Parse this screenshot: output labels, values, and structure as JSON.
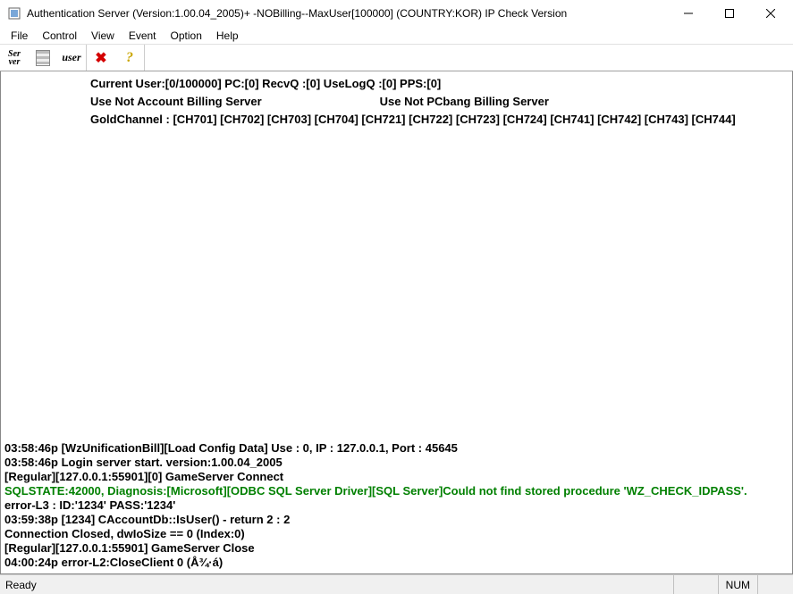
{
  "window": {
    "title": "Authentication Server (Version:1.00.04_2005)+ -NOBilling--MaxUser[100000] (COUNTRY:KOR)  IP Check Version"
  },
  "menu": {
    "items": [
      "File",
      "Control",
      "View",
      "Event",
      "Option",
      "Help"
    ]
  },
  "toolbar": {
    "server_label": "Ser\nver",
    "user_label": "user"
  },
  "status": {
    "line1": "Current User:[0/100000] PC:[0] RecvQ :[0] UseLogQ :[0] PPS:[0]",
    "line2a": "Use Not Account Billing Server",
    "line2b": "Use Not PCbang Billing Server",
    "line3": "GoldChannel :  [CH701] [CH702] [CH703] [CH704] [CH721] [CH722] [CH723] [CH724] [CH741] [CH742] [CH743] [CH744]"
  },
  "log": [
    {
      "text": "03:58:46p [WzUnificationBill][Load Config Data] Use : 0, IP : 127.0.0.1, Port : 45645",
      "color": "black"
    },
    {
      "text": "03:58:46p Login server start. version:1.00.04_2005",
      "color": "black"
    },
    {
      "text": "[Regular][127.0.0.1:55901][0] GameServer Connect",
      "color": "black"
    },
    {
      "text": "SQLSTATE:42000, Diagnosis:[Microsoft][ODBC SQL Server Driver][SQL Server]Could not find stored procedure 'WZ_CHECK_IDPASS'.",
      "color": "green"
    },
    {
      "text": "error-L3 : ID:'1234' PASS:'1234'",
      "color": "black"
    },
    {
      "text": "03:59:38p [1234] CAccountDb::IsUser() - return 2 : 2",
      "color": "black"
    },
    {
      "text": "Connection Closed, dwIoSize == 0 (Index:0)",
      "color": "black"
    },
    {
      "text": "[Regular][127.0.0.1:55901] GameServer Close",
      "color": "black"
    },
    {
      "text": "04:00:24p error-L2:CloseClient 0 (Å¾·á)",
      "color": "black"
    }
  ],
  "statusbar": {
    "ready": "Ready",
    "num": "NUM"
  }
}
